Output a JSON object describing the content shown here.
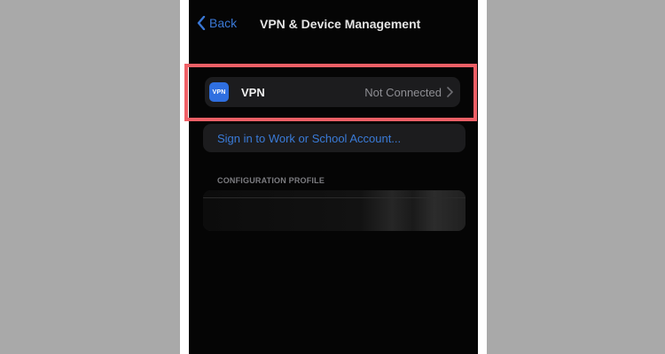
{
  "nav": {
    "back_label": "Back",
    "title": "VPN & Device Management"
  },
  "vpn": {
    "icon_text": "VPN",
    "label": "VPN",
    "status": "Not Connected"
  },
  "signin": {
    "label": "Sign in to Work or School Account..."
  },
  "configuration": {
    "header": "CONFIGURATION PROFILE"
  },
  "colors": {
    "accent_blue": "#3a7bd8",
    "highlight_red": "#ef5f66",
    "background": "#050505",
    "group_bg": "#1c1c1e"
  }
}
